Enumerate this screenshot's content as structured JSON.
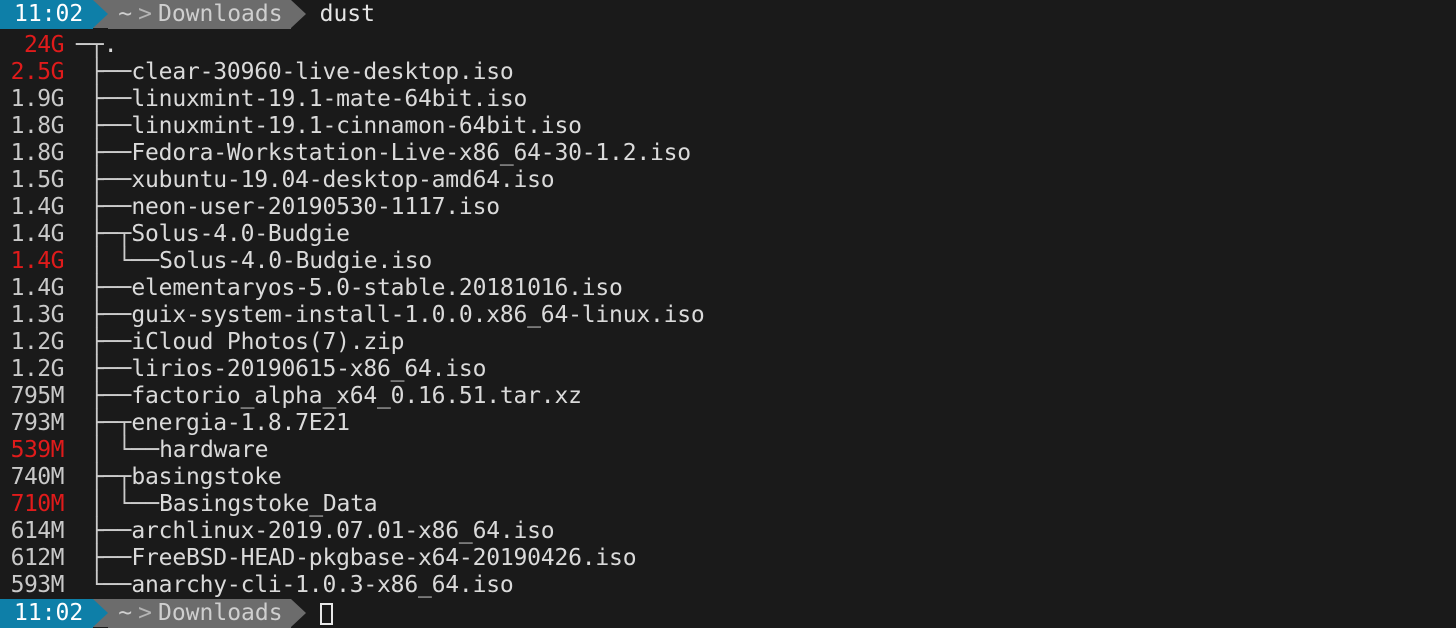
{
  "top_prompt": {
    "time": "11:02",
    "home_crumb": "~",
    "separator": ">",
    "dir_crumb": "Downloads",
    "command": "dust"
  },
  "bottom_prompt": {
    "time": "11:02",
    "home_crumb": "~",
    "separator": ">",
    "dir_crumb": "Downloads",
    "command": "",
    "cursor": "block-cursor"
  },
  "colors": {
    "background": "#1a1a1a",
    "text": "#dadada",
    "size_normal": "#c9c9c9",
    "size_highlight": "#e01b1b",
    "prompt_time_bg": "#0e7fa8",
    "prompt_path_bg": "#6c6c6c",
    "tree_line": "#cbcbcb"
  },
  "tree": {
    "rows": [
      {
        "size": "24G",
        "hot": true,
        "branch": "─┬",
        "name": "."
      },
      {
        "size": "2.5G",
        "hot": true,
        "branch": " ├──",
        "name": "clear-30960-live-desktop.iso"
      },
      {
        "size": "1.9G",
        "hot": false,
        "branch": " ├──",
        "name": "linuxmint-19.1-mate-64bit.iso"
      },
      {
        "size": "1.8G",
        "hot": false,
        "branch": " ├──",
        "name": "linuxmint-19.1-cinnamon-64bit.iso"
      },
      {
        "size": "1.8G",
        "hot": false,
        "branch": " ├──",
        "name": "Fedora-Workstation-Live-x86_64-30-1.2.iso"
      },
      {
        "size": "1.5G",
        "hot": false,
        "branch": " ├──",
        "name": "xubuntu-19.04-desktop-amd64.iso"
      },
      {
        "size": "1.4G",
        "hot": false,
        "branch": " ├──",
        "name": "neon-user-20190530-1117.iso"
      },
      {
        "size": "1.4G",
        "hot": false,
        "branch": " ├─┬",
        "name": "Solus-4.0-Budgie"
      },
      {
        "size": "1.4G",
        "hot": true,
        "branch": " │ └──",
        "name": "Solus-4.0-Budgie.iso"
      },
      {
        "size": "1.4G",
        "hot": false,
        "branch": " ├──",
        "name": "elementaryos-5.0-stable.20181016.iso"
      },
      {
        "size": "1.3G",
        "hot": false,
        "branch": " ├──",
        "name": "guix-system-install-1.0.0.x86_64-linux.iso"
      },
      {
        "size": "1.2G",
        "hot": false,
        "branch": " ├──",
        "name": "iCloud Photos(7).zip"
      },
      {
        "size": "1.2G",
        "hot": false,
        "branch": " ├──",
        "name": "lirios-20190615-x86_64.iso"
      },
      {
        "size": "795M",
        "hot": false,
        "branch": " ├──",
        "name": "factorio_alpha_x64_0.16.51.tar.xz"
      },
      {
        "size": "793M",
        "hot": false,
        "branch": " ├─┬",
        "name": "energia-1.8.7E21"
      },
      {
        "size": "539M",
        "hot": true,
        "branch": " │ └──",
        "name": "hardware"
      },
      {
        "size": "740M",
        "hot": false,
        "branch": " ├─┬",
        "name": "basingstoke"
      },
      {
        "size": "710M",
        "hot": true,
        "branch": " │ └──",
        "name": "Basingstoke_Data"
      },
      {
        "size": "614M",
        "hot": false,
        "branch": " ├──",
        "name": "archlinux-2019.07.01-x86_64.iso"
      },
      {
        "size": "612M",
        "hot": false,
        "branch": " ├──",
        "name": "FreeBSD-HEAD-pkgbase-x64-20190426.iso"
      },
      {
        "size": "593M",
        "hot": false,
        "branch": " └──",
        "name": "anarchy-cli-1.0.3-x86_64.iso"
      }
    ]
  }
}
